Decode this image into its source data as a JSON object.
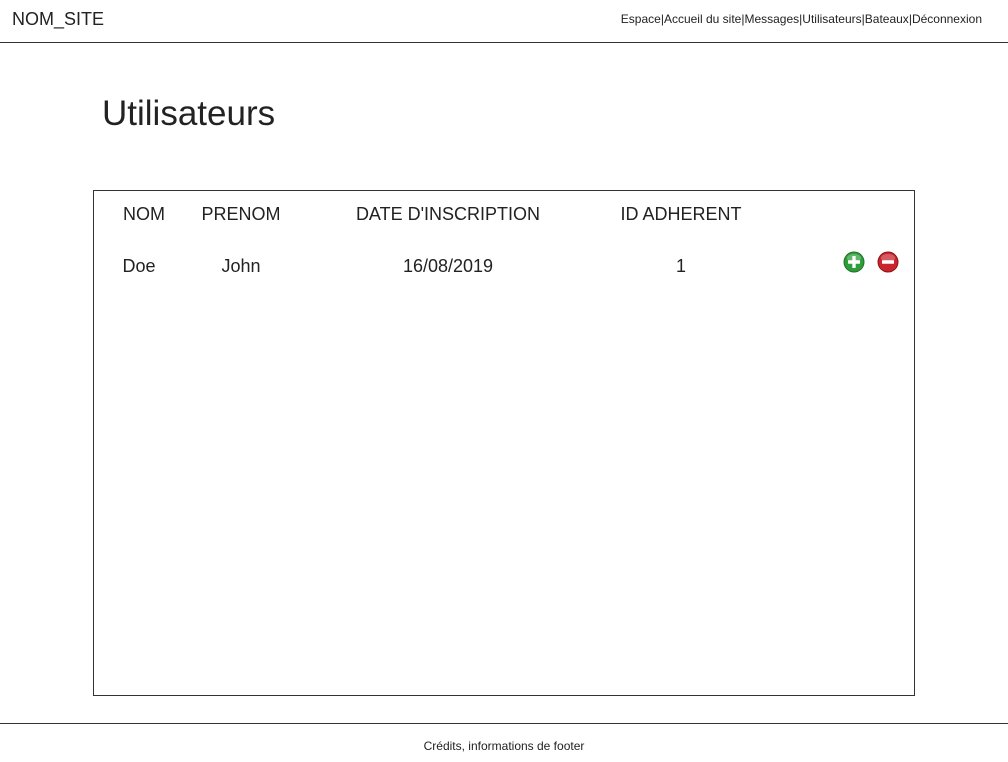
{
  "header": {
    "site_name": "NOM_SITE",
    "nav": [
      "Espace",
      "Accueil du site",
      "Messages",
      "Utilisateurs",
      "Bateaux",
      "Déconnexion"
    ],
    "separator": "|"
  },
  "main": {
    "title": "Utilisateurs",
    "table": {
      "columns": [
        "NOM",
        "PRENOM",
        "DATE D'INSCRIPTION",
        "ID ADHERENT"
      ],
      "rows": [
        {
          "nom": "Doe",
          "prenom": "John",
          "date": "16/08/2019",
          "id": "1"
        }
      ],
      "actions": {
        "add_icon": "plus-circle-icon",
        "remove_icon": "minus-circle-icon"
      }
    }
  },
  "footer": {
    "text": "Crédits, informations de footer"
  },
  "colors": {
    "add": "#2e9e3a",
    "remove": "#c8252d",
    "border": "#333333"
  }
}
